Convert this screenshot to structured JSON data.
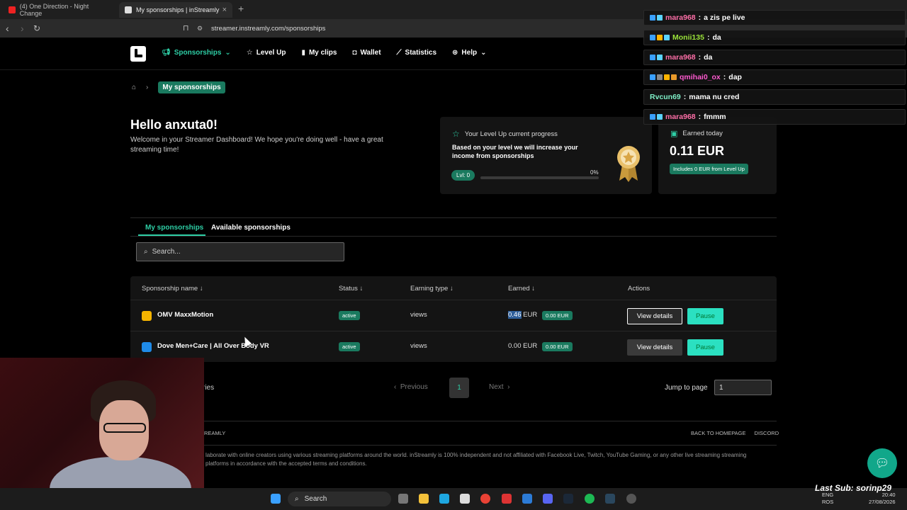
{
  "browser": {
    "tabs": [
      {
        "title": "(4) One Direction - Night Change",
        "icon_color": "#e22"
      },
      {
        "title": "My sponsorships | inStreamly",
        "icon_color": "#ddd"
      }
    ],
    "url": "streamer.instreamly.com/sponsorships"
  },
  "header": {
    "nav": [
      {
        "label": "Sponsorships",
        "icon": "megaphone-icon",
        "active": true
      },
      {
        "label": "Level Up",
        "icon": "star-icon"
      },
      {
        "label": "My clips",
        "icon": "clip-icon"
      },
      {
        "label": "Wallet",
        "icon": "wallet-icon"
      },
      {
        "label": "Statistics",
        "icon": "chart-icon"
      },
      {
        "label": "Help",
        "icon": "help-icon"
      }
    ]
  },
  "breadcrumb": {
    "current": "My sponsorships"
  },
  "greeting": {
    "title": "Hello anxuta0!",
    "subtitle": "Welcome in your Streamer Dashboard! We hope you're doing well - have a great streaming time!"
  },
  "level_card": {
    "title": "Your Level Up current progress",
    "description": "Based on your level we will increase your income from sponsorships",
    "level": "Lvl: 0",
    "progress_text": "0%",
    "progress_fraction": 0
  },
  "earned_card": {
    "title": "Earned today",
    "value": "0.11 EUR",
    "sub": "Includes 0 EUR from Level Up"
  },
  "page_tabs": [
    "My sponsorships",
    "Available sponsorships"
  ],
  "search": {
    "placeholder": "Search..."
  },
  "table": {
    "headers": [
      "Sponsorship name",
      "Status",
      "Earning type",
      "Earned",
      "Actions"
    ],
    "rows": [
      {
        "name": "OMV MaxxMotion",
        "icon_color": "#f5b400",
        "status": "active",
        "earning_type": "views",
        "earned_value": "0.46",
        "earned_unit": "EUR",
        "earned_badge": "0.00 EUR",
        "view": "View details",
        "pause": "Pause"
      },
      {
        "name": "Dove Men+Care | All Over Body VR",
        "icon_color": "#1f8be8",
        "status": "active",
        "earning_type": "views",
        "earned_value": "0.00",
        "earned_unit": "EUR",
        "earned_badge": "0.00 EUR",
        "view": "View details",
        "pause": "Pause"
      }
    ]
  },
  "pagination": {
    "entries_fragment": "ries",
    "previous": "Previous",
    "page": "1",
    "next": "Next",
    "jump_label": "Jump to page",
    "jump_value": "1"
  },
  "footer": {
    "brand": "REAMLY",
    "links": [
      "BACK TO HOMEPAGE",
      "DISCORD"
    ],
    "text": "laborate with online creators using various streaming platforms around the world. inStreamly is 100% independent and not affiliated with Facebook Live, Twitch, YouTube Gaming, or any other live streaming streaming platforms in accordance with the accepted terms and conditions."
  },
  "chat": [
    {
      "user": "mara968",
      "msg": "a zis pe live",
      "color": "#ff6fa8"
    },
    {
      "user": "Monii135",
      "msg": "da",
      "color": "#9be33a"
    },
    {
      "user": "mara968",
      "msg": "da",
      "color": "#ff6fa8"
    },
    {
      "user": "qmihai0_ox",
      "msg": "dap",
      "color": "#ff5ad0"
    },
    {
      "user": "Rvcun69",
      "msg": "mama nu cred",
      "color": "#7ff0c8"
    },
    {
      "user": "mara968",
      "msg": "fmmm",
      "color": "#ff6fa8"
    }
  ],
  "overlay": {
    "last_sub": "Last Sub: sorinp29"
  },
  "taskbar": {
    "search": "Search",
    "lang": "ENG",
    "lang2": "ROS",
    "time": "20:40",
    "date": "27/08/2026"
  },
  "colors": {
    "accent": "#2ecfa6",
    "accent_dark": "#1a7a5f",
    "pause": "#2be0c1"
  }
}
